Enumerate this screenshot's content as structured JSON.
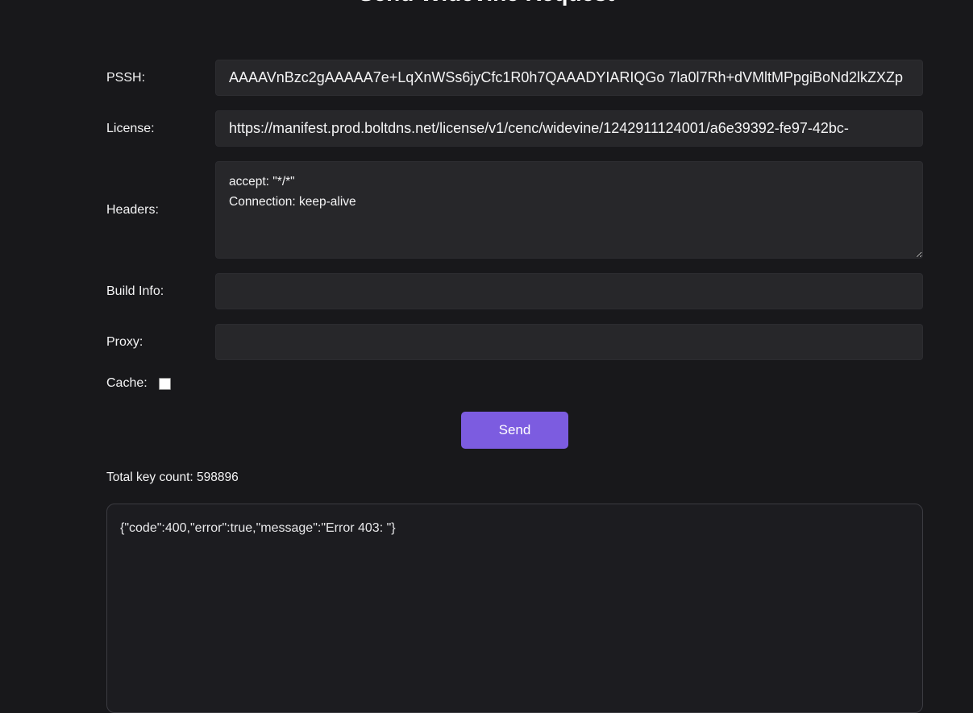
{
  "page": {
    "title": "Send Widevine Request"
  },
  "theme": {
    "accent": "#7c5ce0",
    "background": "#18181b",
    "field_background": "#27272a"
  },
  "form": {
    "pssh": {
      "label": "PSSH:",
      "value": "AAAAVnBzc2gAAAAA7e+LqXnWSs6jyCfc1R0h7QAAADYIARIQGo 7la0l7Rh+dVMltMPpgiBoNd2lkZXZp"
    },
    "license": {
      "label": "License:",
      "value": "https://manifest.prod.boltdns.net/license/v1/cenc/widevine/1242911124001/a6e39392-fe97-42bc-"
    },
    "headers": {
      "label": "Headers:",
      "value": "accept: \"*/*\"\nConnection: keep-alive"
    },
    "build_info": {
      "label": "Build Info:",
      "value": ""
    },
    "proxy": {
      "label": "Proxy:",
      "value": ""
    },
    "cache": {
      "label": "Cache:",
      "checked": false
    },
    "send_label": "Send"
  },
  "status": {
    "total_key_count": "Total key count: 598896"
  },
  "result": {
    "response": "{\"code\":400,\"error\":true,\"message\":\"Error 403: \"}"
  }
}
